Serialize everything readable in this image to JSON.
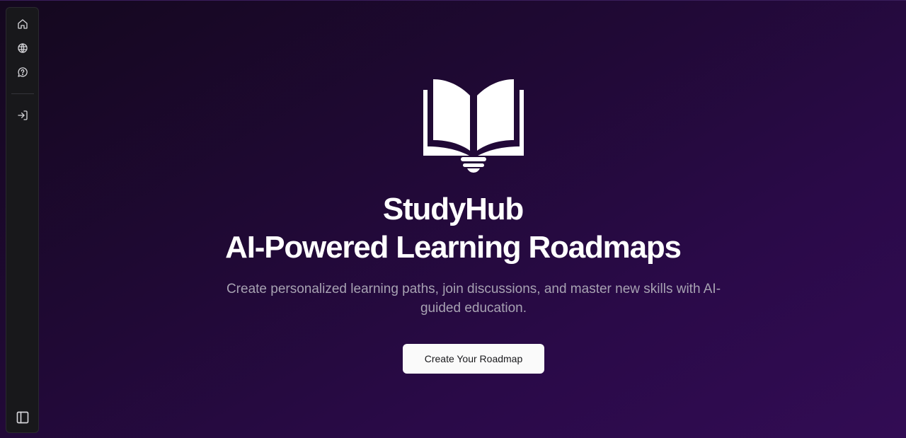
{
  "sidebar": {
    "items": [
      {
        "icon": "home-icon"
      },
      {
        "icon": "globe-icon"
      },
      {
        "icon": "help-circle-icon"
      },
      {
        "icon": "sign-in-icon"
      }
    ],
    "toggle_icon": "sidebar-toggle-icon"
  },
  "hero": {
    "icon": "book-lightbulb-icon",
    "title_line1": "StudyHub",
    "title_line2": "AI-Powered Learning Roadmaps",
    "subtitle": "Create personalized learning paths, join discussions, and master new skills with AI-guided education.",
    "cta_label": "Create Your Roadmap"
  },
  "colors": {
    "background_start": "#14081e",
    "background_end": "#320c54",
    "sidebar_bg": "#18181b",
    "title": "#ffffff",
    "subtitle": "#a7a2b2",
    "button_bg": "#fafafa",
    "button_text": "#18181b"
  }
}
